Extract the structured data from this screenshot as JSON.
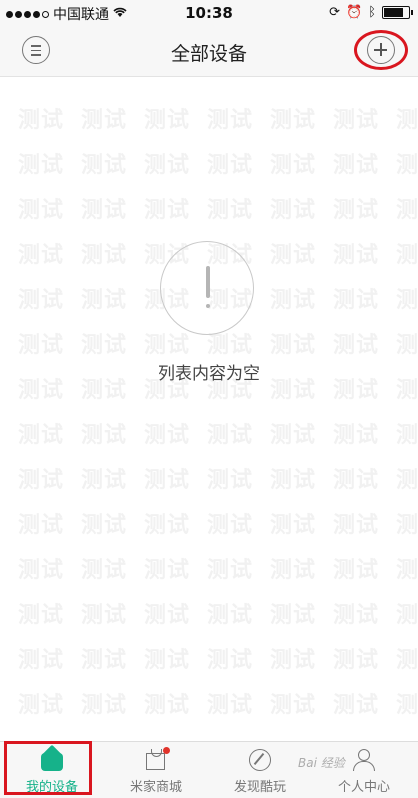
{
  "status_bar": {
    "carrier": "中国联通",
    "time": "10:38",
    "battery_level": 0.85
  },
  "nav": {
    "title": "全部设备"
  },
  "watermark": {
    "text": "测试"
  },
  "empty_state": {
    "message": "列表内容为空"
  },
  "tabs": [
    {
      "label": "我的设备",
      "icon": "home-icon",
      "active": true
    },
    {
      "label": "米家商城",
      "icon": "shopping-bag-icon",
      "active": false
    },
    {
      "label": "发现酷玩",
      "icon": "compass-icon",
      "active": false
    },
    {
      "label": "个人中心",
      "icon": "person-icon",
      "active": false
    }
  ],
  "overlay": {
    "baidu_mark": "Bai 经验"
  },
  "colors": {
    "accent": "#16b28a",
    "highlight_red": "#d9161f",
    "badge_red": "#e0332b"
  }
}
